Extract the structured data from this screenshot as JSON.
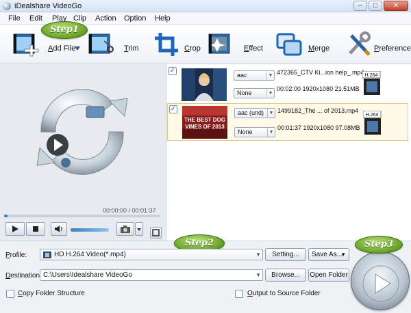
{
  "window": {
    "title": "iDealshare VideoGo"
  },
  "menu": [
    "File",
    "Edit",
    "Play",
    "Clip",
    "Action",
    "Option",
    "Help"
  ],
  "toolbar": {
    "add_file": "Add File",
    "trim": "Trim",
    "crop": "Crop",
    "effect": "Effect",
    "merge": "Merge",
    "preference": "Preference"
  },
  "steps": {
    "step1": "Step1",
    "step2": "Step2",
    "step3": "Step3"
  },
  "player": {
    "timecode": "00:00:00 / 00:01:37",
    "progress": 0.02,
    "volume": 0.9
  },
  "files": [
    {
      "name": "472365_CTV Ki...ion help_.mp4",
      "audio": "aac",
      "subtitle": "None",
      "info": "00:02:00  1920x1080  21.51MB",
      "codec_badge": "H.264",
      "checked": true,
      "thumb_text": ""
    },
    {
      "name": "1499182_The ... of 2013.mp4",
      "audio": "aac (und)",
      "subtitle": "None",
      "info": "00:01:37  1920x1080  97.08MB",
      "codec_badge": "H.264",
      "checked": true,
      "thumb_text": "THE BEST DOG VINES OF 2013"
    }
  ],
  "output": {
    "profile_label": "Profile:",
    "profile_value": "HD H.264 Video(*.mp4)",
    "setting_button": "Setting...",
    "save_as_button": "Save As...",
    "destination_label": "Destination:",
    "destination_value": "C:\\Users\\Idealshare VideoGo",
    "browse_button": "Browse...",
    "open_folder_button": "Open Folder",
    "copy_folder_label": "Copy Folder Structure",
    "output_source_label": "Output to Source Folder"
  },
  "colors": {
    "accent": "#3b7fc4",
    "step_green": "#5f9a1c",
    "selected_row": "#fff9e8"
  }
}
